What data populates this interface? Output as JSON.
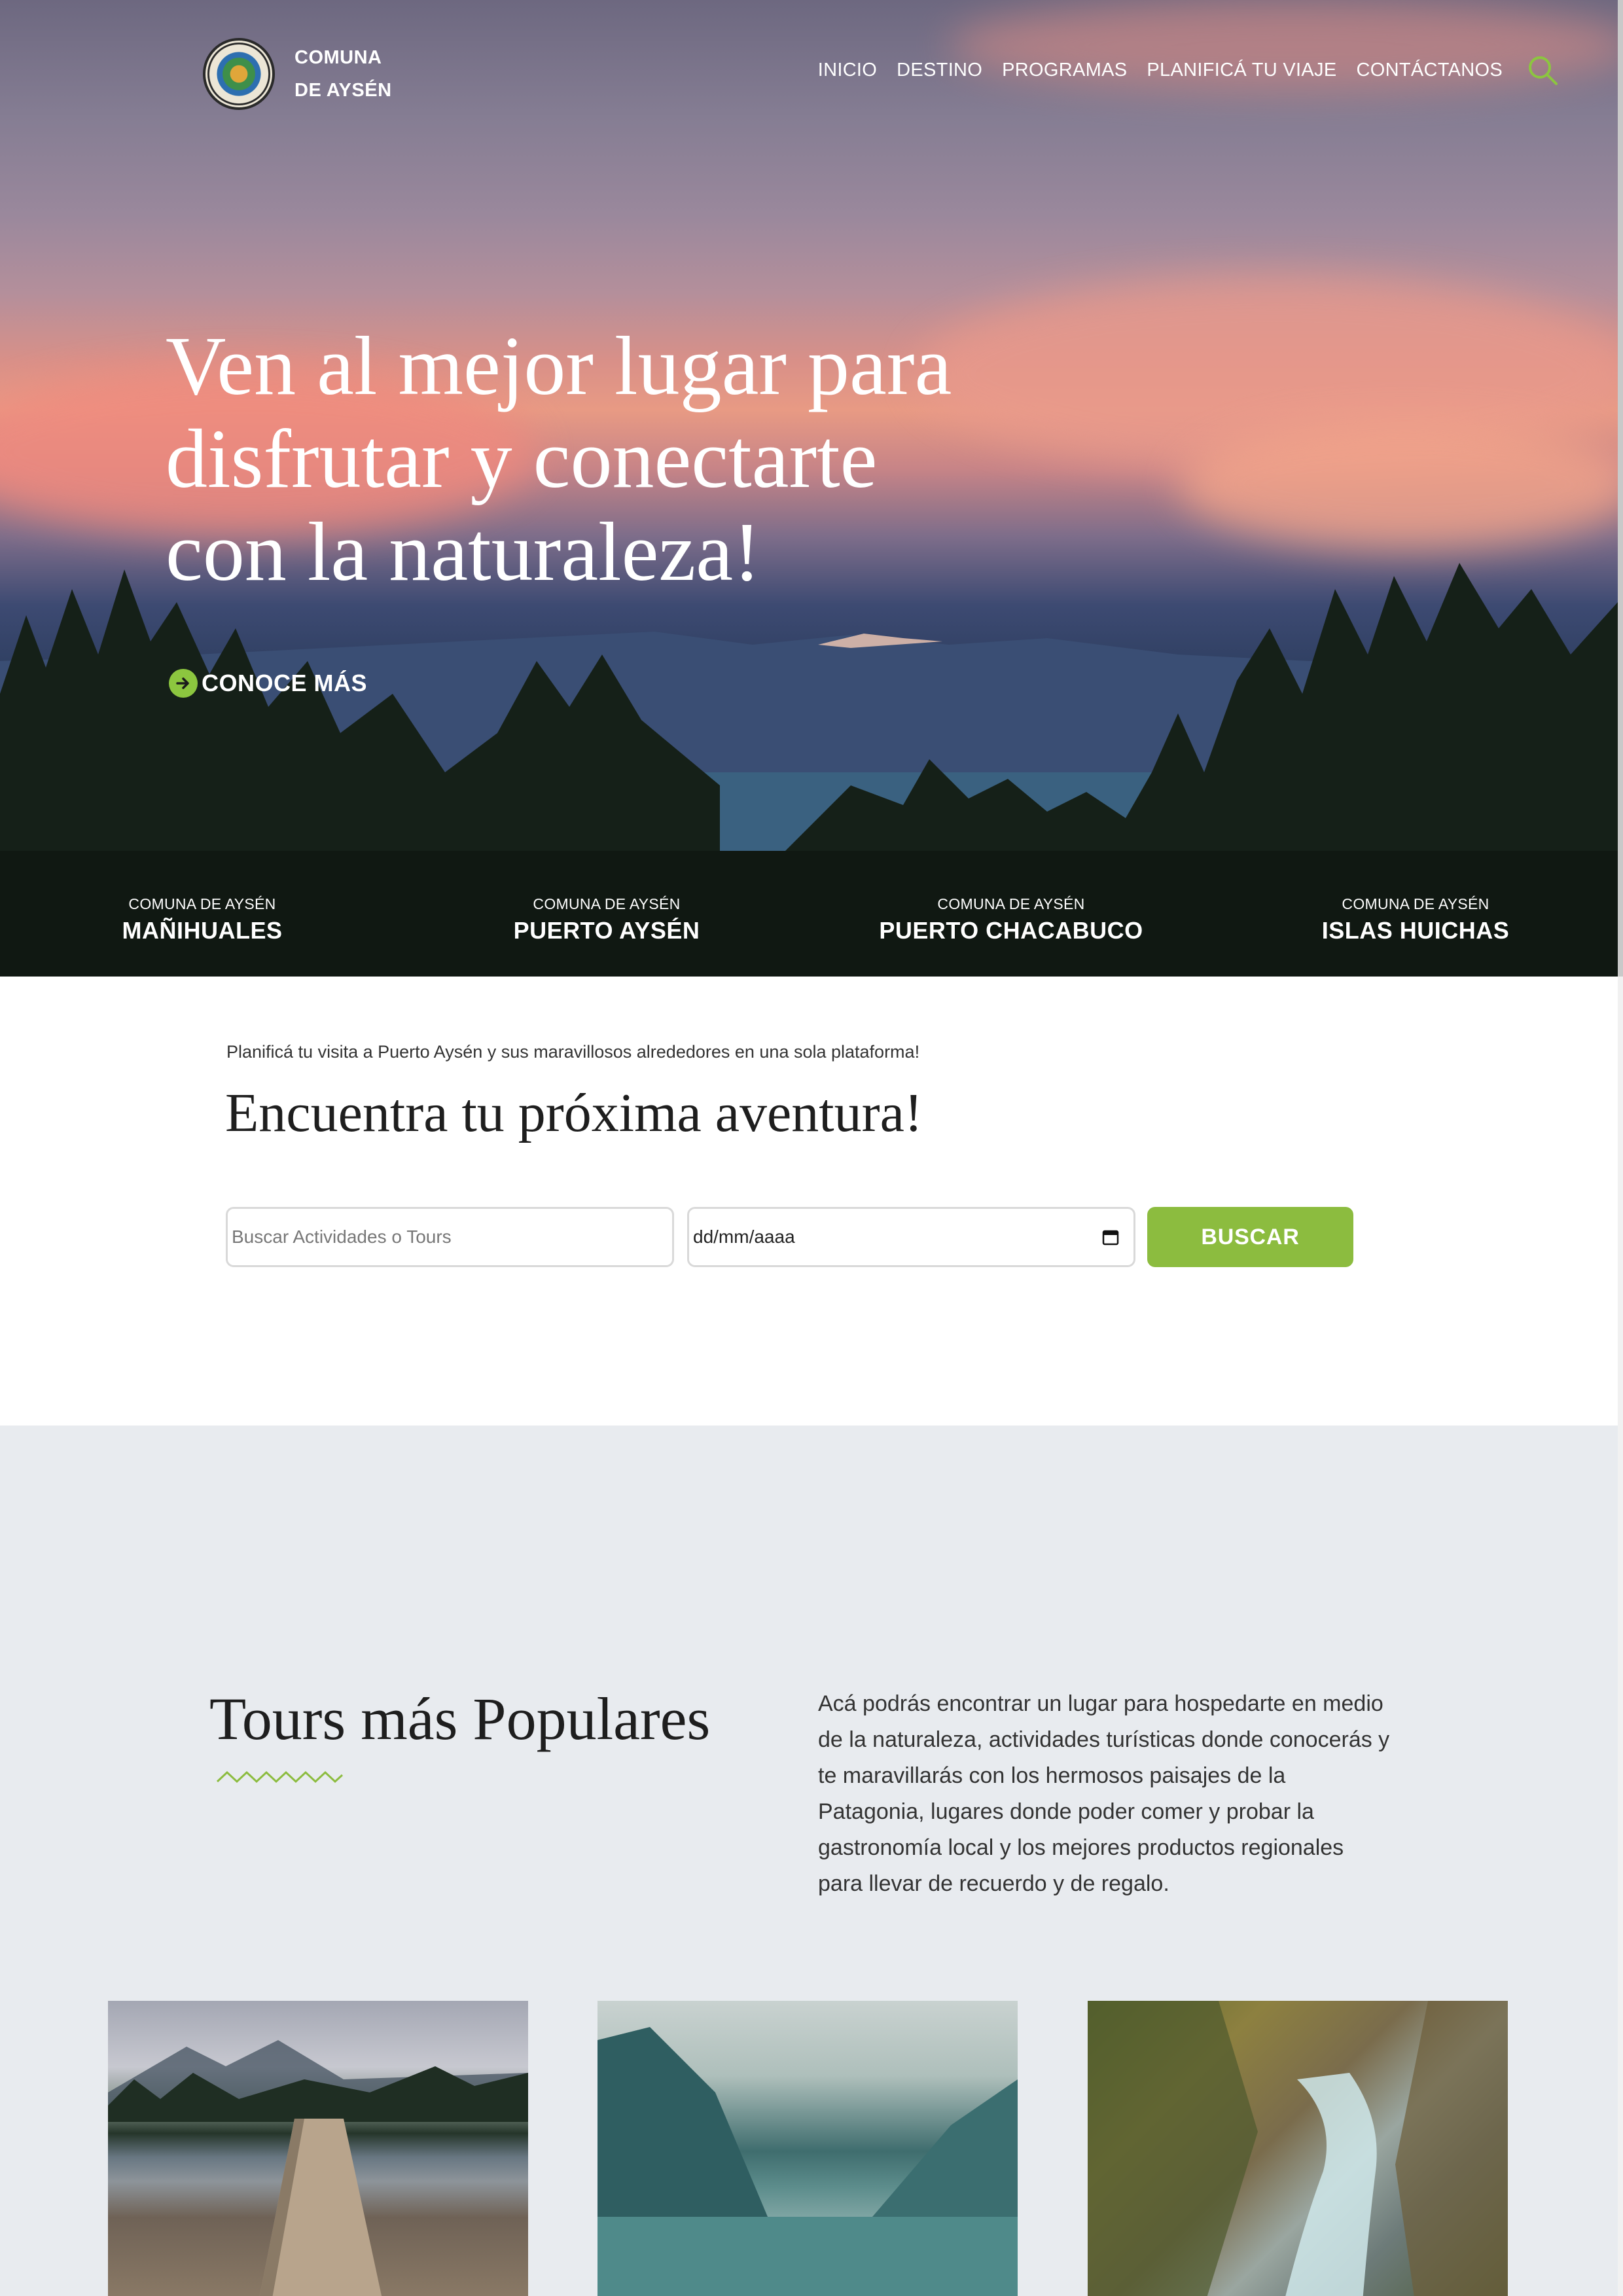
{
  "brand": {
    "line1": "COMUNA",
    "line2": "DE AYSÉN"
  },
  "nav": {
    "items": [
      "INICIO",
      "DESTINO",
      "PROGRAMAS",
      "PLANIFICÁ TU VIAJE",
      "CONTÁCTANOS"
    ],
    "search_icon": "search-icon"
  },
  "hero": {
    "title_line1": "Ven al mejor lugar para",
    "title_line2": "disfrutar y conectarte",
    "title_line3": "con la naturaleza!",
    "cta": "CONOCE MÁS"
  },
  "destinations": [
    {
      "pre": "COMUNA DE AYSÉN",
      "name": "MAÑIHUALES"
    },
    {
      "pre": "COMUNA DE AYSÉN",
      "name": "PUERTO AYSÉN"
    },
    {
      "pre": "COMUNA DE AYSÉN",
      "name": "PUERTO CHACABUCO"
    },
    {
      "pre": "COMUNA DE AYSÉN",
      "name": "ISLAS HUICHAS"
    }
  ],
  "plan": {
    "subtitle": "Planificá tu visita a Puerto Aysén y sus maravillosos alrededores en una sola plataforma!",
    "title": "Encuentra tu próxima aventura!",
    "search_placeholder": "Buscar Actividades o Tours",
    "date_placeholder": "dd/mm/aaaa",
    "button": "BUSCAR"
  },
  "tours": {
    "title": "Tours más Populares",
    "description": "Acá podrás encontrar un lugar para hospedarte en medio de la naturaleza, actividades turísticas donde conocerás y te maravillarás con los hermosos paisajes de la Patagonia, lugares donde poder comer y probar la gastronomía local y los mejores productos regionales para llevar de recuerdo y de regalo."
  },
  "colors": {
    "accent": "#8cbc3f",
    "section_bg": "#e8ebef"
  }
}
